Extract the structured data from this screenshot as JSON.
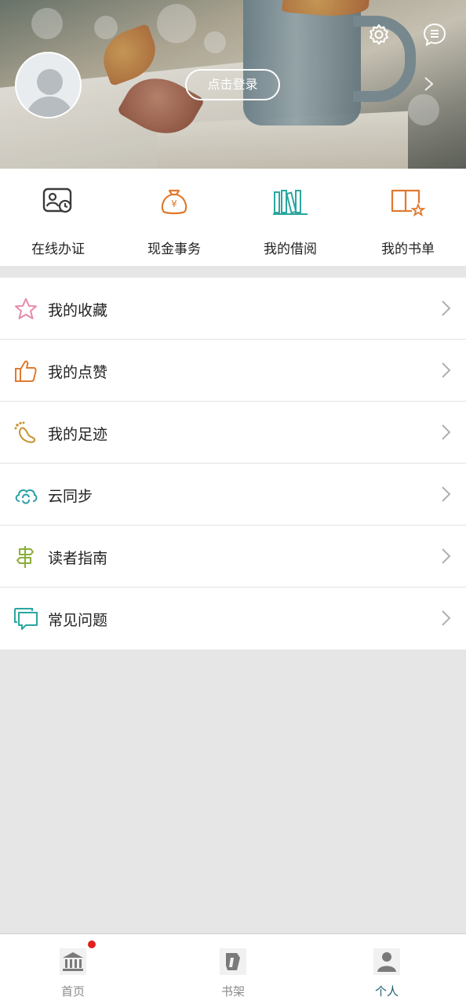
{
  "header": {
    "login_label": "点击登录",
    "icons": [
      "settings-icon",
      "message-icon",
      "chevron-right-icon",
      "avatar"
    ]
  },
  "quick_actions": [
    {
      "label": "在线办证",
      "icon": "id-card-clock-icon",
      "color": "#3a3a3a"
    },
    {
      "label": "现金事务",
      "icon": "money-bag-icon",
      "color": "#e07a2e"
    },
    {
      "label": "我的借阅",
      "icon": "bookshelf-icon",
      "color": "#2aa6a0"
    },
    {
      "label": "我的书单",
      "icon": "book-star-icon",
      "color": "#e07a2e"
    }
  ],
  "menu": [
    {
      "label": "我的收藏",
      "icon": "star-icon",
      "color": "#e58aa8"
    },
    {
      "label": "我的点赞",
      "icon": "thumbs-up-icon",
      "color": "#e07a2e"
    },
    {
      "label": "我的足迹",
      "icon": "footprint-icon",
      "color": "#c9932f"
    },
    {
      "label": "云同步",
      "icon": "cloud-sync-icon",
      "color": "#2a9fa6"
    },
    {
      "label": "读者指南",
      "icon": "signpost-icon",
      "color": "#8bae3a"
    },
    {
      "label": "常见问题",
      "icon": "chat-bubbles-icon",
      "color": "#2aa6a0"
    }
  ],
  "bottom_nav": [
    {
      "label": "首页",
      "icon": "library-building-icon",
      "active": false,
      "badge": true
    },
    {
      "label": "书架",
      "icon": "bookshelf-nav-icon",
      "active": false,
      "badge": false
    },
    {
      "label": "个人",
      "icon": "person-icon",
      "active": true,
      "badge": false
    }
  ],
  "colors": {
    "active_nav": "#1d5f6c",
    "badge": "#e02020",
    "background": "#e6e6e6"
  }
}
